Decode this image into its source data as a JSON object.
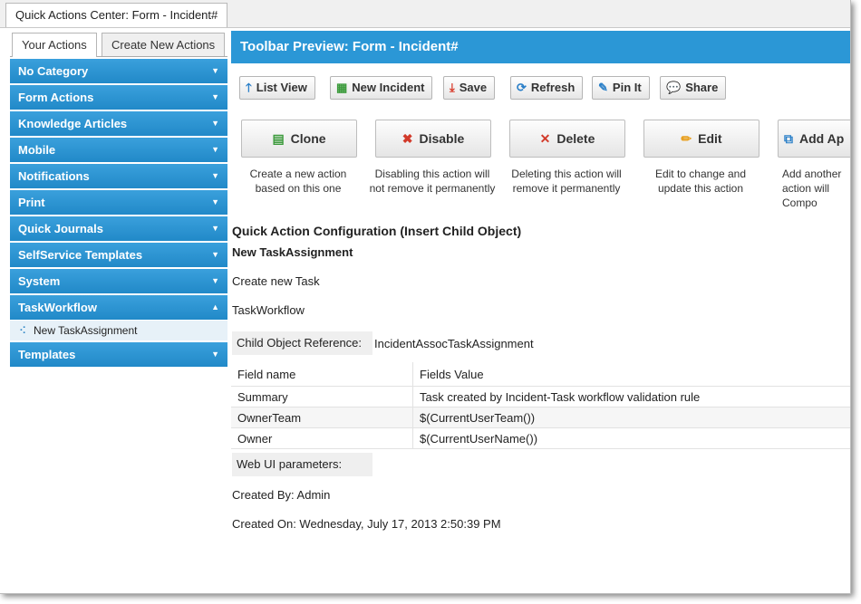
{
  "window": {
    "tab_title": "Quick Actions Center: Form - Incident#"
  },
  "sidebar": {
    "tabs": [
      "Your Actions",
      "Create New Actions"
    ],
    "categories": [
      "No Category",
      "Form Actions",
      "Knowledge Articles",
      "Mobile",
      "Notifications",
      "Print",
      "Quick Journals",
      "SelfService Templates",
      "System",
      "TaskWorkflow",
      "Templates"
    ],
    "expanded_item": "New TaskAssignment",
    "icons": {
      "collapsed": "▼",
      "expanded": "▲",
      "item": "⠪"
    }
  },
  "main": {
    "header": "Toolbar Preview: Form - Incident#",
    "toolbar": [
      {
        "label": "List View",
        "icon": "arrow-up-icon",
        "glyph": "🡑",
        "color": "#2a7fc8"
      },
      {
        "label": "New Incident",
        "icon": "new-incident-icon",
        "glyph": "▦",
        "color": "#3a9a3a"
      },
      {
        "label": "Save",
        "icon": "save-icon",
        "glyph": "⤓",
        "color": "#d83a2a"
      },
      {
        "label": "Refresh",
        "icon": "refresh-icon",
        "glyph": "⟳",
        "color": "#2a7fc8"
      },
      {
        "label": "Pin It",
        "icon": "pin-icon",
        "glyph": "✎",
        "color": "#2a7fc8"
      },
      {
        "label": "Share",
        "icon": "share-icon",
        "glyph": "💬",
        "color": "#222222"
      }
    ],
    "actions": [
      {
        "label": "Clone",
        "icon": "clone-icon",
        "glyph": "▤",
        "color": "#3a9a3a",
        "description": "Create a new action based on this one"
      },
      {
        "label": "Disable",
        "icon": "disable-icon",
        "glyph": "✖",
        "color": "#d23a2a",
        "description": "Disabling this action will not remove it permanently"
      },
      {
        "label": "Delete",
        "icon": "delete-icon",
        "glyph": "✕",
        "color": "#d23a2a",
        "description": "Deleting this action will remove it permanently"
      },
      {
        "label": "Edit",
        "icon": "edit-icon",
        "glyph": "✏",
        "color": "#e8a020",
        "description": "Edit to change and update this action"
      },
      {
        "label": "Add Ap",
        "icon": "add-icon",
        "glyph": "⧉",
        "color": "#2a7fc8",
        "description": "Add another action will Compo"
      }
    ],
    "config": {
      "title": "Quick Action Configuration (Insert Child Object)",
      "subtitle": "New TaskAssignment",
      "line1": "Create new Task",
      "line2": "TaskWorkflow",
      "child_ref_label": "Child Object Reference:",
      "child_ref_value": "IncidentAssocTaskAssignment",
      "table_headers": [
        "Field name",
        "Fields Value"
      ],
      "table_rows": [
        [
          "Summary",
          "Task created by Incident-Task workflow validation rule"
        ],
        [
          "OwnerTeam",
          "$(CurrentUserTeam())"
        ],
        [
          "Owner",
          "$(CurrentUserName())"
        ]
      ],
      "web_ui_label": "Web UI parameters:",
      "created_by": "Created By: Admin",
      "created_on": "Created On: Wednesday, July 17, 2013 2:50:39 PM"
    }
  }
}
